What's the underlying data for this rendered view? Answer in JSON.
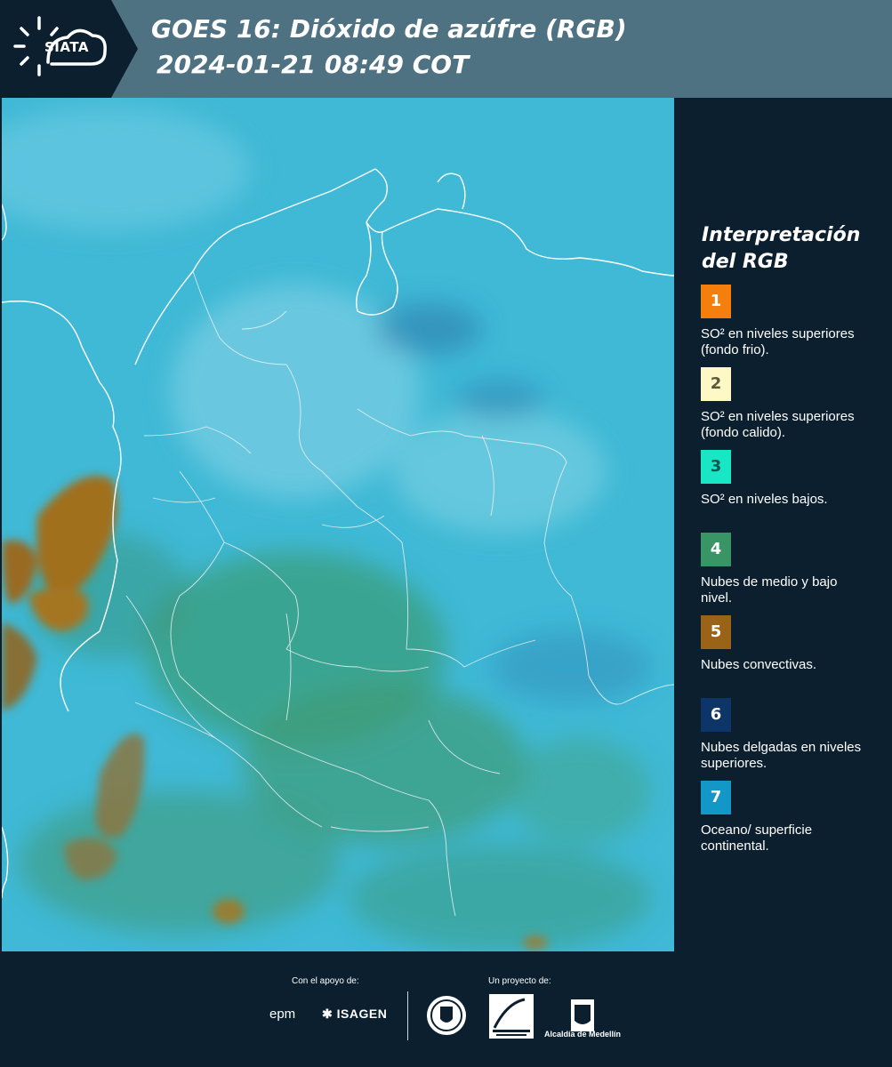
{
  "header": {
    "logo_text": "SIATA",
    "title_line1": "GOES 16: Dióxido de azúfre (RGB)",
    "title_line2": "2024-01-21 08:49 COT"
  },
  "legend": {
    "title_line1": "Interpretación",
    "title_line2": "del RGB",
    "items": [
      {
        "number": "1",
        "color": "#f57f0c",
        "text_color": "#ffffff",
        "label": "SO² en niveles superiores (fondo frio)."
      },
      {
        "number": "2",
        "color": "#fdf8c6",
        "text_color": "#5a5a3a",
        "label": "SO² en niveles superiores (fondo calido)."
      },
      {
        "number": "3",
        "color": "#18e6c4",
        "text_color": "#0b5a50",
        "label": "SO² en niveles bajos."
      },
      {
        "number": "4",
        "color": "#3a9566",
        "text_color": "#ffffff",
        "label": "Nubes de medio y bajo nivel."
      },
      {
        "number": "5",
        "color": "#9b6318",
        "text_color": "#ffffff",
        "label": "Nubes convectivas."
      },
      {
        "number": "6",
        "color": "#0d3568",
        "text_color": "#ffffff",
        "label": "Nubes delgadas en niveles superiores."
      },
      {
        "number": "7",
        "color": "#1397c6",
        "text_color": "#ffffff",
        "label": "Oceano/ superficie continental."
      }
    ]
  },
  "footer": {
    "support_label": "Con el apoyo de:",
    "project_label": "Un proyecto de:",
    "epm": "epm",
    "isagen": "ISAGEN",
    "alcaldia": "Alcaldía de Medellín"
  },
  "colors": {
    "background": "#0b1f2e",
    "header": "#4f7282",
    "map_base": "#3bb7d4"
  }
}
